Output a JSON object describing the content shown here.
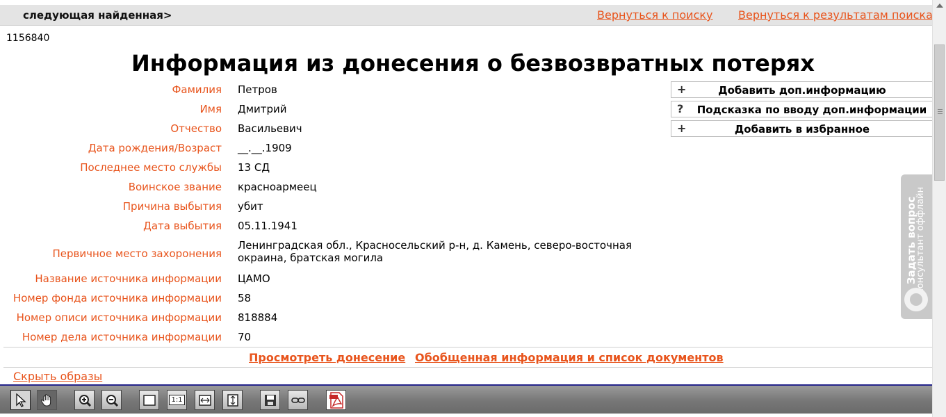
{
  "topbar": {
    "next_found": "следующая найденная>",
    "back_to_search": "Вернуться к поиску",
    "back_to_results": "Вернуться к результатам поиска"
  },
  "record_id": "1156840",
  "title": "Информация из донесения о безвозвратных потерях",
  "fields": [
    {
      "label": "Фамилия",
      "value": "Петров"
    },
    {
      "label": "Имя",
      "value": "Дмитрий"
    },
    {
      "label": "Отчество",
      "value": "Васильевич"
    },
    {
      "label": "Дата рождения/Возраст",
      "value": "__.__.1909"
    },
    {
      "label": "Последнее место службы",
      "value": "13 СД"
    },
    {
      "label": "Воинское звание",
      "value": "красноармеец"
    },
    {
      "label": "Причина выбытия",
      "value": "убит"
    },
    {
      "label": "Дата выбытия",
      "value": "05.11.1941"
    },
    {
      "label": "Первичное место захоронения",
      "value": "Ленинградская обл., Красносельский р-н, д. Камень, северо-восточная окраина, братская могила"
    },
    {
      "label": "Название источника информации",
      "value": "ЦАМО"
    },
    {
      "label": "Номер фонда источника информации",
      "value": "58"
    },
    {
      "label": "Номер описи источника информации",
      "value": "818884"
    },
    {
      "label": "Номер дела источника информации",
      "value": "70"
    }
  ],
  "side_buttons": [
    {
      "symbol": "+",
      "label": "Добавить доп.информацию",
      "icon": "plus-icon"
    },
    {
      "symbol": "?",
      "label": "Подсказка по вводу доп.информации",
      "icon": "question-icon"
    },
    {
      "symbol": "+",
      "label": "Добавить в избранное",
      "icon": "plus-icon"
    }
  ],
  "bottom_links": {
    "view_report": "Просмотреть донесение",
    "summary": "Обобщенная информация и список документов"
  },
  "hide_images": "Скрыть образы",
  "toolbar": {
    "zoom_1to1": "1:1",
    "tools": [
      "select-pointer-icon",
      "pan-hand-icon",
      "zoom-in-icon",
      "zoom-out-icon",
      "fit-page-icon",
      "actual-size-icon",
      "fit-width-icon",
      "fit-height-icon",
      "save-icon",
      "link-icon",
      "pdf-icon"
    ]
  },
  "consultant": {
    "line1": "Задать вопрос",
    "line2": "консультант оффлайн"
  },
  "colors": {
    "link": "#e8541c",
    "topbar_bg": "#e4e4e4",
    "toolbar_bg": "#777777",
    "toolbar_border": "#23238a"
  }
}
